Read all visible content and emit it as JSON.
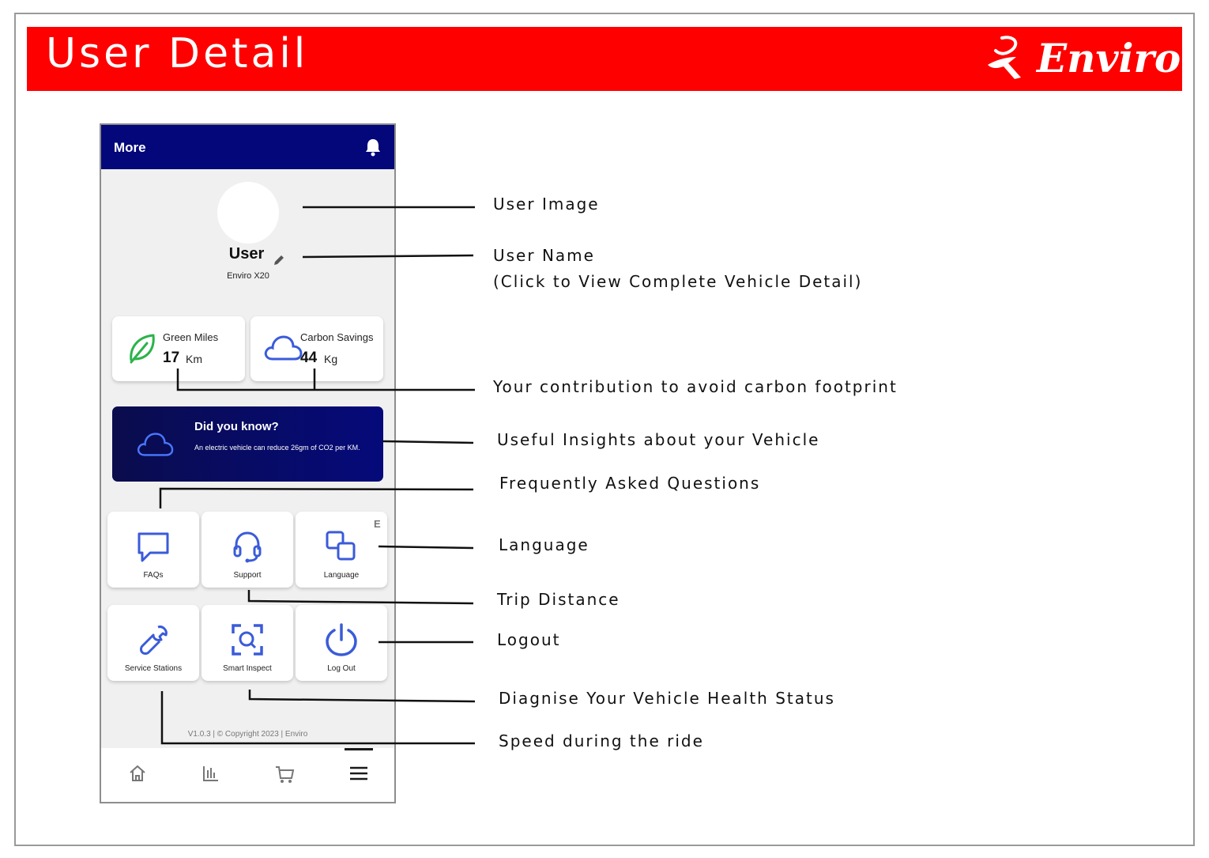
{
  "banner": {
    "title": "User Detail",
    "brand": "Enviro",
    "color": "#ff0000"
  },
  "phone": {
    "header_title": "More",
    "header_color": "#03077a",
    "profile": {
      "name": "User",
      "vehicle": "Enviro X20"
    },
    "stats": [
      {
        "label": "Green Miles",
        "value": "17",
        "unit": "Km",
        "icon": "leaf-icon"
      },
      {
        "label": "Carbon Savings",
        "value": "44",
        "unit": "Kg",
        "icon": "cloud-icon"
      }
    ],
    "insight": {
      "title": "Did you know?",
      "text": "An electric vehicle can reduce 26gm of CO2 per KM."
    },
    "tiles": [
      {
        "label": "FAQs",
        "icon": "chat-bubble-icon"
      },
      {
        "label": "Support",
        "icon": "headset-icon"
      },
      {
        "label": "Language",
        "icon": "translate-icon",
        "badge": "E"
      },
      {
        "label": "Service Stations",
        "icon": "wrench-icon"
      },
      {
        "label": "Smart Inspect",
        "icon": "scan-icon"
      },
      {
        "label": "Log Out",
        "icon": "power-icon"
      }
    ],
    "footer": "V1.0.3 | © Copyright 2023 | Enviro",
    "nav": [
      "home-icon",
      "stats-icon",
      "cart-icon",
      "menu-icon"
    ],
    "accent": "#3a5bd9"
  },
  "annotations": {
    "user_image": "User Image",
    "user_name": "User Name",
    "user_name_sub": "(Click to View Complete Vehicle Detail)",
    "contribution": "Your contribution to avoid carbon footprint",
    "insights": "Useful Insights about your Vehicle",
    "faq": "Frequently Asked Questions",
    "language": "Language",
    "trip": "Trip Distance",
    "logout": "Logout",
    "diagnose": "Diagnise Your Vehicle Health Status",
    "speed": "Speed during the ride"
  }
}
